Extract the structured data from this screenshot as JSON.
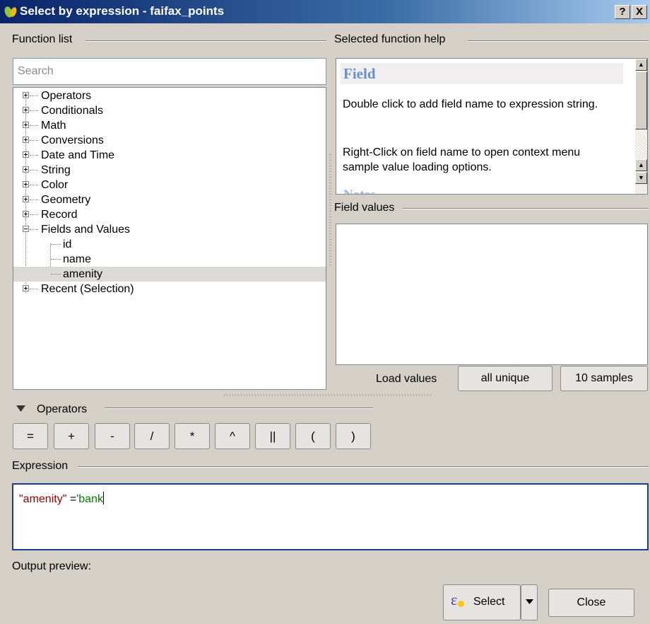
{
  "window": {
    "title": "Select by expression - faifax_points",
    "help_button": "?",
    "close_button": "X"
  },
  "function_list": {
    "label": "Function list",
    "search_placeholder": "Search",
    "items": [
      {
        "label": "Operators",
        "expander": "plus"
      },
      {
        "label": "Conditionals",
        "expander": "plus"
      },
      {
        "label": "Math",
        "expander": "plus"
      },
      {
        "label": "Conversions",
        "expander": "plus"
      },
      {
        "label": "Date and Time",
        "expander": "plus"
      },
      {
        "label": "String",
        "expander": "plus"
      },
      {
        "label": "Color",
        "expander": "plus"
      },
      {
        "label": "Geometry",
        "expander": "plus"
      },
      {
        "label": "Record",
        "expander": "plus"
      },
      {
        "label": "Fields and Values",
        "expander": "minus"
      },
      {
        "label": "id",
        "child": true
      },
      {
        "label": "name",
        "child": true
      },
      {
        "label": "amenity",
        "child": true,
        "selected": true
      },
      {
        "label": "Recent (Selection)",
        "expander": "plus"
      }
    ]
  },
  "help": {
    "label": "Selected function help",
    "title": "Field",
    "p1": "Double click to add field name to expression string.",
    "p2": "Right-Click on field name to open context menu sample value loading options.",
    "next_heading_partial": "Notes"
  },
  "field_values": {
    "label": "Field values",
    "load_values_label": "Load values",
    "all_unique_button": "all unique",
    "samples_button": "10 samples"
  },
  "operators": {
    "label": "Operators",
    "buttons": [
      "=",
      "+",
      "-",
      "/",
      "*",
      "^",
      "||",
      "(",
      ")"
    ]
  },
  "expression": {
    "label": "Expression",
    "field_token": "\"amenity\"",
    "operator_token": " =",
    "string_token": "'bank",
    "colors": {
      "field": "#8b0000",
      "string": "#008000"
    }
  },
  "output_preview": {
    "label": "Output preview:"
  },
  "footer": {
    "select_button": "Select",
    "close_button": "Close"
  }
}
